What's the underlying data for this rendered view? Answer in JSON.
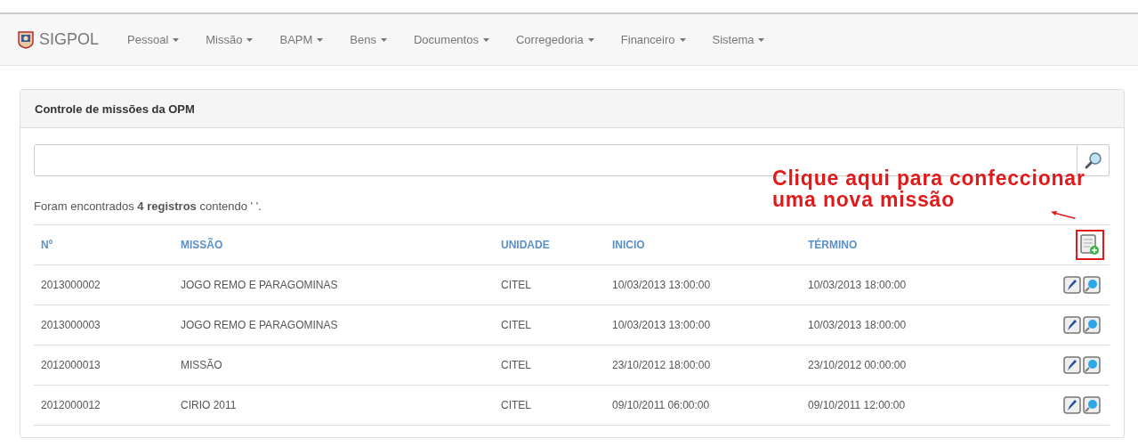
{
  "navbar": {
    "brand": "SIGPOL",
    "menus": [
      {
        "label": "Pessoal"
      },
      {
        "label": "Missão"
      },
      {
        "label": "BAPM"
      },
      {
        "label": "Bens"
      },
      {
        "label": "Documentos"
      },
      {
        "label": "Corregedoria"
      },
      {
        "label": "Financeiro"
      },
      {
        "label": "Sistema"
      }
    ]
  },
  "panel": {
    "title": "Controle de missões da OPM",
    "summary": "Foram encontrados **4 registros** contendo ' '.",
    "table": {
      "columns": [
        "Nº",
        "MISSÃO",
        "UNIDADE",
        "INICIO",
        "TÉRMINO"
      ],
      "rows": [
        [
          "2013000002",
          "JOGO REMO E PARAGOMINAS",
          "CITEL",
          "10/03/2013 13:00:00",
          "10/03/2013 18:00:00"
        ],
        [
          "2013000003",
          "JOGO REMO E PARAGOMINAS",
          "CITEL",
          "10/03/2013 13:00:00",
          "10/03/2013 18:00:00"
        ],
        [
          "2012000013",
          "MISSÃO",
          "CITEL",
          "23/10/2012 18:00:00",
          "23/10/2012 00:00:00"
        ],
        [
          "2012000012",
          "CIRIO 2011",
          "CITEL",
          "09/10/2011 06:00:00",
          "09/10/2011 12:00:00"
        ]
      ]
    }
  },
  "annotation": {
    "text": "Clique aqui para confeccionar uma nova missão"
  }
}
